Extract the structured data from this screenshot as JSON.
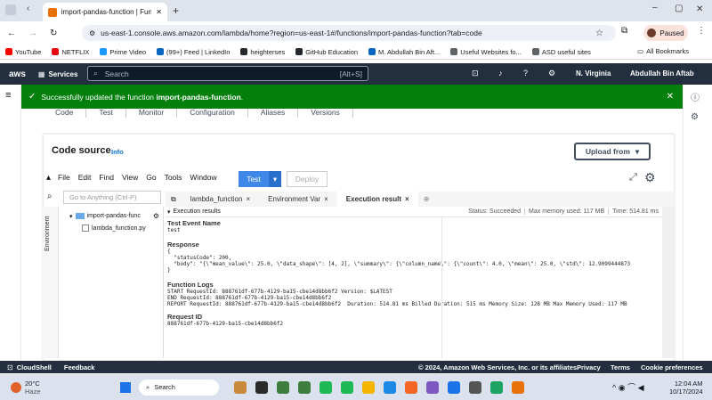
{
  "browser": {
    "tab_title": "import-pandas-function | Functi",
    "url": "us-east-1.console.aws.amazon.com/lambda/home?region=us-east-1#/functions/import-pandas-function?tab=code",
    "profile_status": "Paused",
    "bookmarks": [
      {
        "label": "YouTube",
        "color": "#ff0000"
      },
      {
        "label": "NETFLIX",
        "color": "#e50914"
      },
      {
        "label": "Prime Video",
        "color": "#1a98ff"
      },
      {
        "label": "(99+) Feed | LinkedIn",
        "color": "#0a66c2"
      },
      {
        "label": "heighterses",
        "color": "#24292f"
      },
      {
        "label": "GitHub Education",
        "color": "#24292f"
      },
      {
        "label": "M. Abdullah Bin Aft...",
        "color": "#0a66c2"
      },
      {
        "label": "Useful Websites fo...",
        "color": "#5f6368"
      },
      {
        "label": "ASD useful sites",
        "color": "#5f6368"
      }
    ],
    "all_bookmarks": "All Bookmarks"
  },
  "aws": {
    "logo": "aws",
    "services": "Services",
    "search_placeholder": "Search",
    "search_shortcut": "[Alt+S]",
    "region": "N. Virginia",
    "user": "Abdullah Bin Aftab"
  },
  "flash": {
    "prefix": "Successfully updated the function ",
    "function_name": "import-pandas-function",
    "suffix": "."
  },
  "func_tabs": [
    "Code",
    "Test",
    "Monitor",
    "Configuration",
    "Aliases",
    "Versions"
  ],
  "code_source": {
    "title": "Code source",
    "info": "Info",
    "upload": "Upload from"
  },
  "ide": {
    "menus": [
      "File",
      "Edit",
      "Find",
      "View",
      "Go",
      "Tools",
      "Window"
    ],
    "test": "Test",
    "deploy": "Deploy",
    "goto_placeholder": "Go to Anything (Ctrl-P)",
    "env_label": "Environment",
    "folder": "import-pandas-func",
    "file": "lambda_function.py",
    "tabs": [
      {
        "label": "lambda_function",
        "active": false
      },
      {
        "label": "Environment Var",
        "active": false
      },
      {
        "label": "Execution result",
        "active": true
      }
    ]
  },
  "results": {
    "header": "Execution results",
    "status": "Status: Succeeded",
    "max_memory": "Max memory used: 117 MB",
    "time": "Time: 514.81 ms",
    "event_name_label": "Test Event Name",
    "event_name": "test",
    "response_label": "Response",
    "response_lines": [
      "{",
      "  \"statusCode\": 200,",
      "  \"body\": \"{\\\"mean_value\\\": 25.0, \\\"data_shape\\\": [4, 2], \\\"summary\\\": {\\\"column_name\\\": {\\\"count\\\": 4.0, \\\"mean\\\": 25.0, \\\"std\\\": 12.9099444873",
      "}"
    ],
    "logs_label": "Function Logs",
    "log_lines": [
      "START RequestId: 888761df-677b-4129-ba15-cbe14d8bb6f2 Version: $LATEST",
      "END RequestId: 888761df-677b-4129-ba15-cbe14d8bb6f2",
      "REPORT RequestId: 888761df-677b-4129-ba15-cbe14d8bb6f2  Duration: 514.81 ms Billed Duration: 515 ms Memory Size: 128 MB Max Memory Used: 117 MB"
    ],
    "request_label": "Request ID",
    "request_id": "888761df-677b-4129-ba15-cbe14d8bb6f2"
  },
  "footer": {
    "cloudshell": "CloudShell",
    "feedback": "Feedback",
    "copyright": "© 2024, Amazon Web Services, Inc. or its affiliates.",
    "privacy": "Privacy",
    "terms": "Terms",
    "cookies": "Cookie preferences"
  },
  "taskbar": {
    "weather_temp": "20°C",
    "weather_desc": "Haze",
    "search": "Search",
    "time": "12:04 AM",
    "date": "10/17/2024"
  }
}
